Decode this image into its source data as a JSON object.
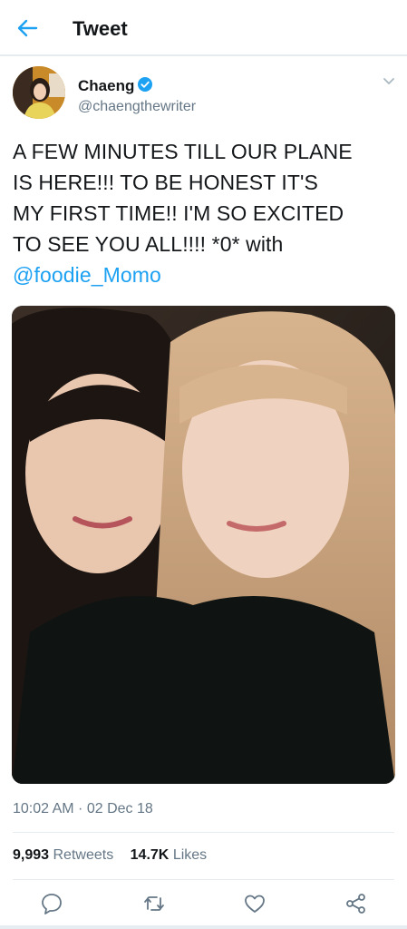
{
  "header": {
    "title": "Tweet",
    "back_icon": "back-arrow-icon"
  },
  "author": {
    "display_name": "Chaeng",
    "handle": "@chaengthewriter",
    "verified": true,
    "verified_color": "#1da1f2"
  },
  "tweet": {
    "lines": [
      "A FEW MINUTES TILL OUR PLANE",
      "IS HERE!!! TO BE HONEST IT'S",
      "MY FIRST TIME!! I'M SO EXCITED",
      "TO SEE YOU ALL!!!! *0* with"
    ],
    "mention": "@foodie_Momo",
    "timestamp": "10:02 AM · 02 Dec 18"
  },
  "stats": {
    "retweets_count": "9,993",
    "retweets_label": "Retweets",
    "likes_count": "14.7K",
    "likes_label": "Likes"
  },
  "actions": [
    "reply-icon",
    "retweet-icon",
    "like-icon",
    "share-icon"
  ],
  "colors": {
    "accent": "#1da1f2",
    "text": "#14171a",
    "secondary": "#657786",
    "divider": "#e6ecf0"
  }
}
